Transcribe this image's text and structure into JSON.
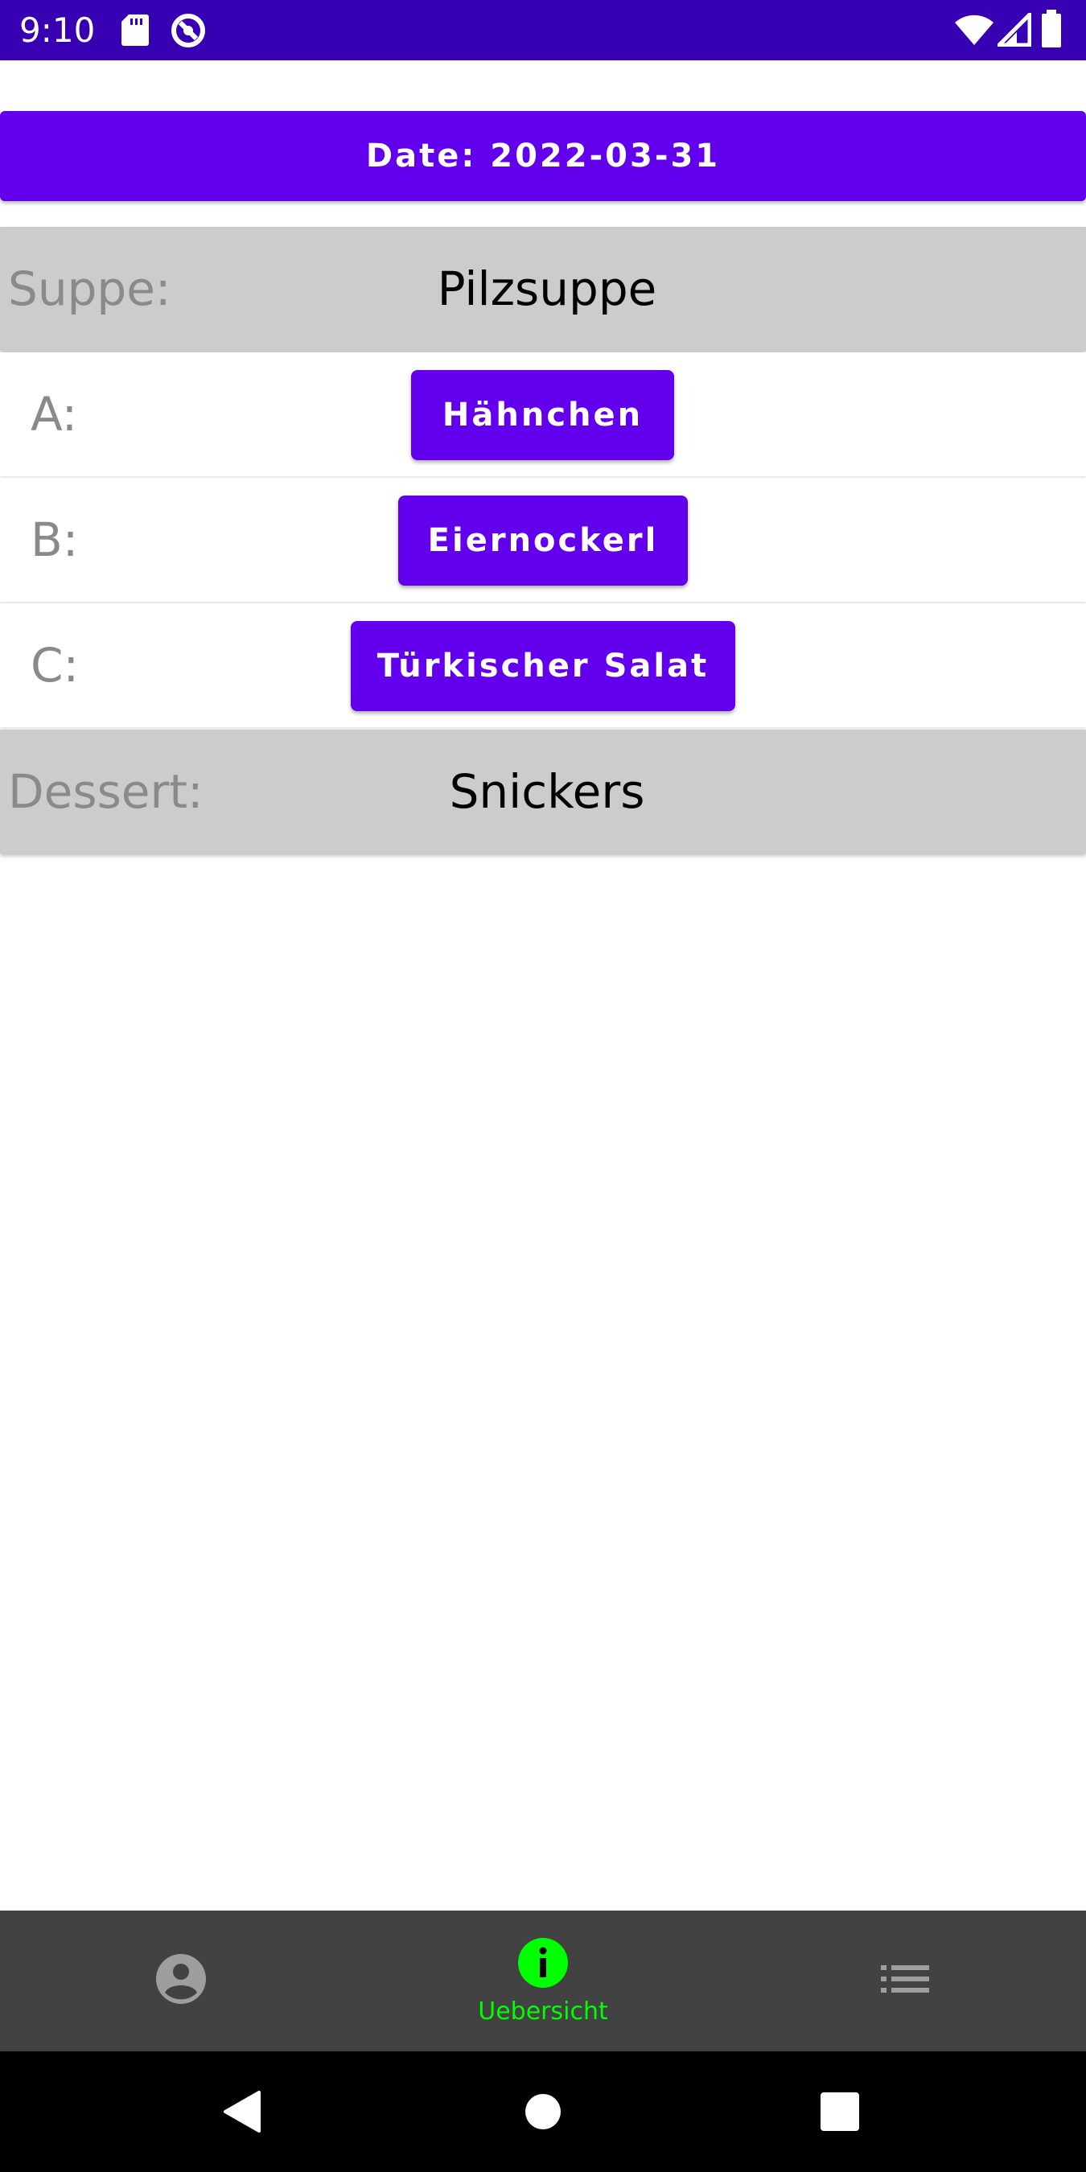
{
  "status_bar": {
    "time": "9:10",
    "background_color": "#3700b3",
    "left_icons": [
      "sd-card-icon",
      "data-saver-icon"
    ],
    "right_icons": [
      "wifi-icon",
      "signal-icon",
      "battery-icon"
    ]
  },
  "header": {
    "date_text": "Date: 2022-03-31",
    "background_color": "#6200ee"
  },
  "menu": {
    "soup": {
      "label": "Suppe:",
      "value": "Pilzsuppe"
    },
    "option_a": {
      "label": "A:",
      "button_label": "Hähnchen"
    },
    "option_b": {
      "label": "B:",
      "button_label": "Eiernockerl"
    },
    "option_c": {
      "label": "C:",
      "button_label": "Türkischer Salat"
    },
    "dessert": {
      "label": "Dessert:",
      "value": "Snickers"
    },
    "button_color": "#6200ee",
    "highlight_row_color": "#cccccc"
  },
  "bottom_nav": {
    "background_color": "#424242",
    "active_color": "#00ff00",
    "items": [
      {
        "icon": "account-circle-icon",
        "label": "",
        "active": false
      },
      {
        "icon": "info-icon",
        "label": "Uebersicht",
        "active": true
      },
      {
        "icon": "list-icon",
        "label": "",
        "active": false
      }
    ]
  },
  "system_nav": {
    "buttons": [
      "back-icon",
      "home-icon",
      "recents-icon"
    ]
  }
}
